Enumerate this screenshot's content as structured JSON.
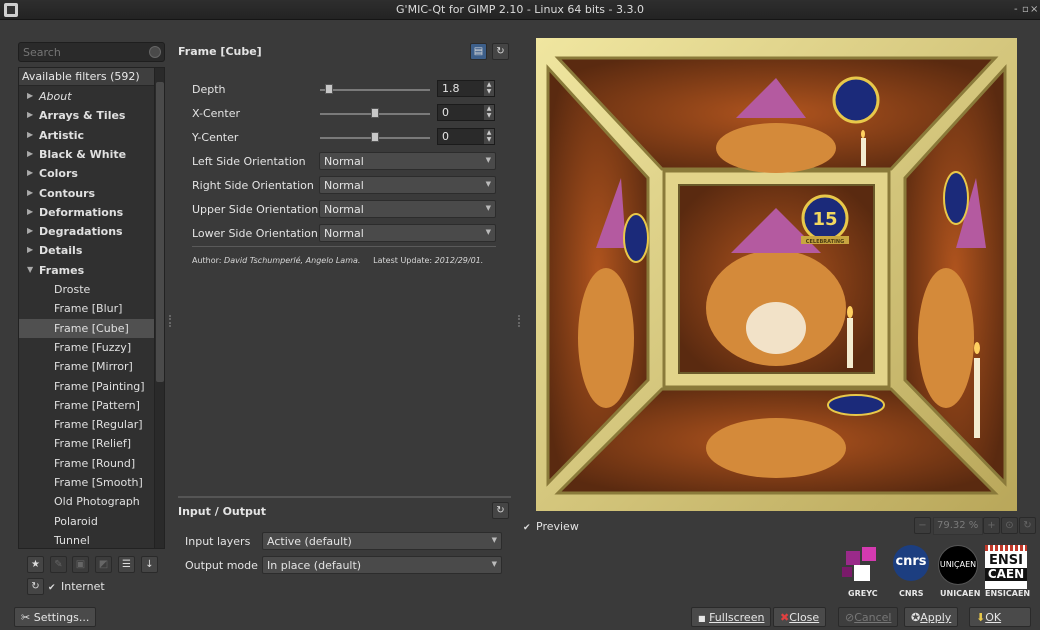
{
  "window": {
    "title": "G'MIC-Qt for GIMP 2.10 - Linux 64 bits - 3.3.0",
    "controls": [
      "-",
      "▫",
      "×"
    ]
  },
  "search": {
    "placeholder": "Search"
  },
  "filters": {
    "header": "Available filters (592)",
    "items": [
      {
        "label": "About",
        "type": "cat-italic"
      },
      {
        "label": "Arrays & Tiles",
        "type": "cat"
      },
      {
        "label": "Artistic",
        "type": "cat"
      },
      {
        "label": "Black & White",
        "type": "cat"
      },
      {
        "label": "Colors",
        "type": "cat"
      },
      {
        "label": "Contours",
        "type": "cat"
      },
      {
        "label": "Deformations",
        "type": "cat"
      },
      {
        "label": "Degradations",
        "type": "cat"
      },
      {
        "label": "Details",
        "type": "cat"
      },
      {
        "label": "Frames",
        "type": "cat-open"
      },
      {
        "label": "Droste",
        "type": "leaf"
      },
      {
        "label": "Frame [Blur]",
        "type": "leaf"
      },
      {
        "label": "Frame [Cube]",
        "type": "leaf-selected"
      },
      {
        "label": "Frame [Fuzzy]",
        "type": "leaf"
      },
      {
        "label": "Frame [Mirror]",
        "type": "leaf"
      },
      {
        "label": "Frame [Painting]",
        "type": "leaf"
      },
      {
        "label": "Frame [Pattern]",
        "type": "leaf"
      },
      {
        "label": "Frame [Regular]",
        "type": "leaf"
      },
      {
        "label": "Frame [Relief]",
        "type": "leaf"
      },
      {
        "label": "Frame [Round]",
        "type": "leaf"
      },
      {
        "label": "Frame [Smooth]",
        "type": "leaf"
      },
      {
        "label": "Old Photograph",
        "type": "leaf"
      },
      {
        "label": "Polaroid",
        "type": "leaf"
      },
      {
        "label": "Tunnel",
        "type": "leaf"
      }
    ]
  },
  "internet": {
    "label": "Internet",
    "checked": true
  },
  "settings_label": "Settings...",
  "filter": {
    "title": "Frame [Cube]",
    "depth": {
      "label": "Depth",
      "value": "1.8",
      "level": 0.08
    },
    "x_center": {
      "label": "X-Center",
      "value": "0",
      "level": 0.5
    },
    "y_center": {
      "label": "Y-Center",
      "value": "0",
      "level": 0.5
    },
    "left_side": {
      "label": "Left Side Orientation",
      "value": "Normal"
    },
    "right_side": {
      "label": "Right Side Orientation",
      "value": "Normal"
    },
    "upper_side": {
      "label": "Upper Side Orientation",
      "value": "Normal"
    },
    "lower_side": {
      "label": "Lower Side Orientation",
      "value": "Normal"
    },
    "author_prefix": "Author:",
    "author": "David Tschumperlé, Angelo Lama.",
    "update_prefix": "Latest Update:",
    "update": "2012/29/01."
  },
  "io": {
    "title": "Input / Output",
    "input_label": "Input layers",
    "input_value": "Active (default)",
    "output_label": "Output mode",
    "output_value": "In place (default)"
  },
  "preview": {
    "label": "Preview",
    "checked": true,
    "zoom": "79.32 %"
  },
  "logos": [
    {
      "name": "GREYC"
    },
    {
      "name": "CNRS",
      "mark": "cnrs"
    },
    {
      "name": "UNICAEN",
      "mark": "UNIÇAEN"
    },
    {
      "name": "ENSICAEN",
      "mark_top": "ENSI",
      "mark_bottom": "CAEN"
    }
  ],
  "badge_number": "15",
  "badge_ribbon": "CELEBRATING",
  "buttons": {
    "fullscreen": "Fullscreen",
    "close": "Close",
    "cancel": "Cancel",
    "apply": "Apply",
    "ok": "OK"
  },
  "colors": {
    "accent_gold": "#e6d98a",
    "frame_inner": "#bdb06a",
    "background": "#3a3a3a"
  }
}
